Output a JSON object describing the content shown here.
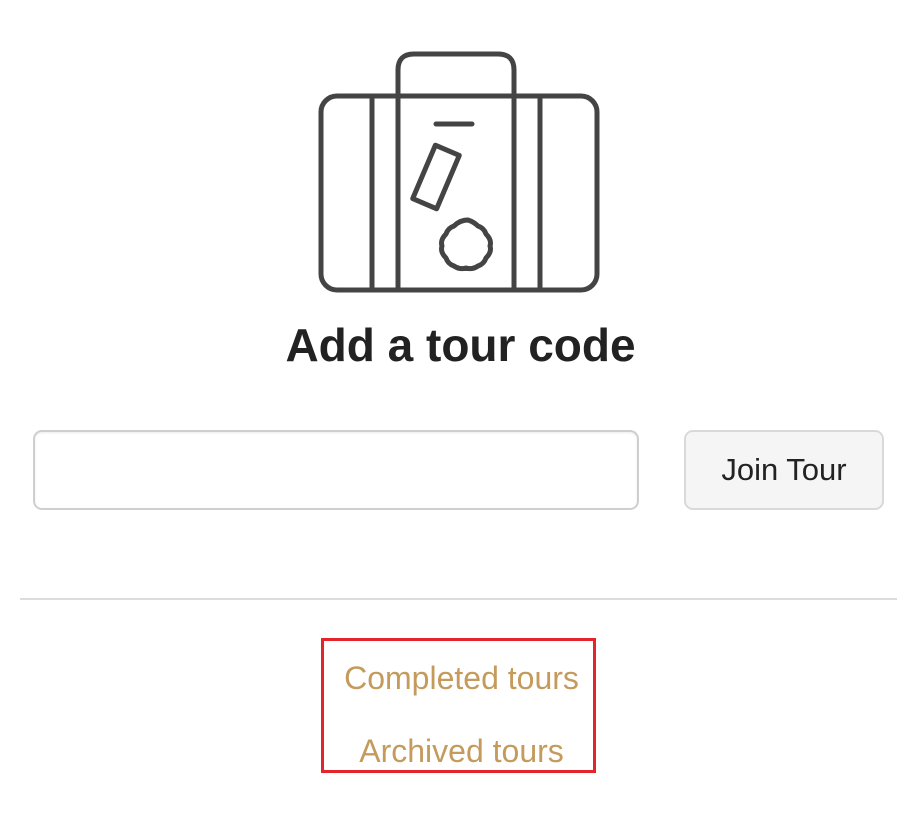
{
  "icons": {
    "hero": "suitcase-icon"
  },
  "header": {
    "title": "Add a tour code"
  },
  "tour_code": {
    "value": "",
    "placeholder": ""
  },
  "actions": {
    "join_label": "Join Tour"
  },
  "links": {
    "completed": "Completed tours",
    "archived": "Archived tours"
  },
  "colors": {
    "link": "#c49b5c",
    "highlight_border": "#e3242b",
    "icon_stroke": "#444444",
    "title": "#222222"
  }
}
